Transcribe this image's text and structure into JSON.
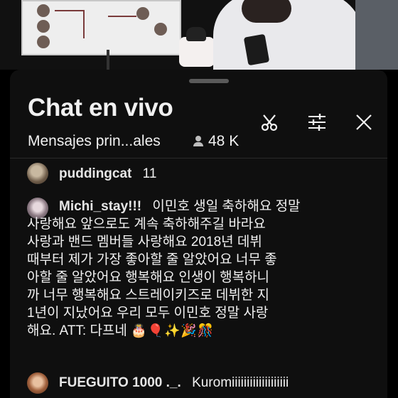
{
  "header": {
    "title": "Chat en vivo",
    "mode_label": "Mensajes prin...ales",
    "viewer_count": "48 K"
  },
  "icons": {
    "clip": "scissors-icon",
    "settings": "sliders-icon",
    "close": "close-icon",
    "viewers": "person-icon"
  },
  "messages": [
    {
      "author": "puddingcat",
      "text": "11"
    },
    {
      "author": "Michi_stay!!!",
      "lines": [
        "이민호 생일 축하해요 정말",
        "사랑해요 앞으로도 계속 축하해주길 바라요",
        "사랑과 밴드 멤버들 사랑해요 2018년 데뷔",
        "때부터 제가 가장 좋아할 줄 알았어요 너무 좋",
        "아할 줄 알았어요 행복해요 인생이 행복하니",
        "까 너무 행복해요 스트레이키즈로 데뷔한 지",
        "1년이 지났어요 우리 모두 이민호 정말 사랑",
        "해요. ATT: 다프네"
      ],
      "emoji": "🎂🎈✨🎉🎊"
    },
    {
      "author": "FUEGUITO 1000 ._.",
      "text": "Kuromiiiiiiiiiiiiiiiiiii"
    }
  ]
}
